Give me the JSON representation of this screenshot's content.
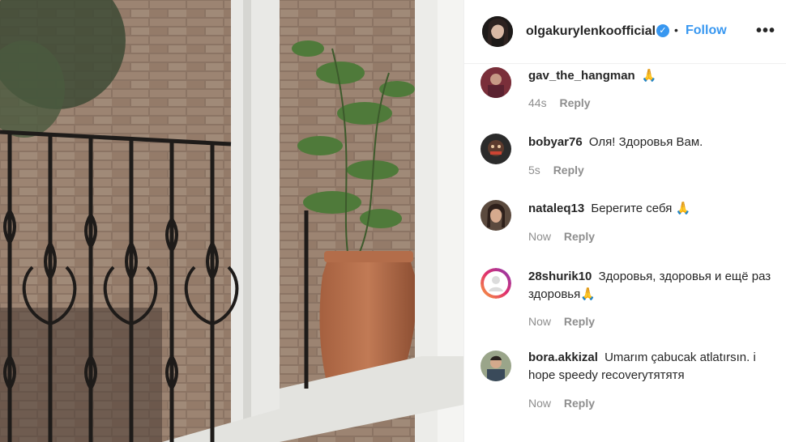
{
  "header": {
    "username": "olgakurylenkoofficial",
    "verified_mark": "✓",
    "separator": "•",
    "follow_label": "Follow",
    "more_label": "•••"
  },
  "comments": [
    {
      "user": "gav_the_hangman",
      "text": "🙏",
      "time": "44s",
      "reply": "Reply",
      "avatar_color": "#7a2f3a"
    },
    {
      "user": "bobyar76",
      "text": "Оля! Здоровья Вам.",
      "time": "5s",
      "reply": "Reply",
      "avatar_color": "#2b2b2b"
    },
    {
      "user": "nataleq13",
      "text": "Берегите себя 🙏",
      "time": "Now",
      "reply": "Reply",
      "avatar_color": "#5b4a3e"
    },
    {
      "user": "28shurik10",
      "text": "Здоровья, здоровья и ещё раз здоровья🙏",
      "time": "Now",
      "reply": "Reply",
      "avatar_color": "#c13584"
    },
    {
      "user": "bora.akkizal",
      "text": "Umarım çabucak atlatırsın. i hope speedy recoveryтятятя",
      "time": "Now",
      "reply": "Reply",
      "avatar_color": "#6c7a5c"
    }
  ],
  "colors": {
    "accent": "#3897f0",
    "muted": "#8e8e8e",
    "text": "#262626",
    "border": "#efefef"
  }
}
